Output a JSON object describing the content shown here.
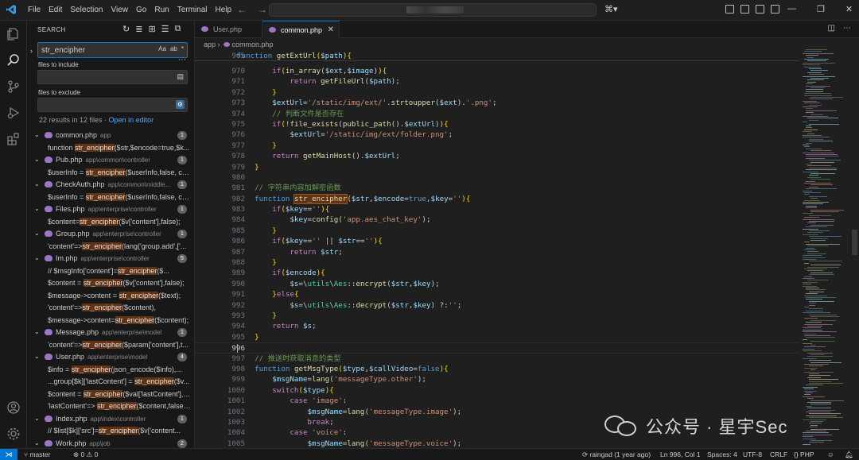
{
  "titlebar": {
    "menu": [
      "File",
      "Edit",
      "Selection",
      "View",
      "Go",
      "Run",
      "Terminal",
      "Help"
    ]
  },
  "colors": {
    "accent": "#0078d4",
    "match_highlight": "#613214",
    "php_icon": "#a074c4"
  },
  "sidebar": {
    "title": "SEARCH",
    "search_value": "str_encipher",
    "search_opts": [
      "Aa",
      "ab",
      "*"
    ],
    "include_label": "files to include",
    "exclude_label": "files to exclude",
    "summary": "22 results in 12 files",
    "open_in_editor": "Open in editor",
    "files": [
      {
        "name": "common.php",
        "path": "app",
        "count": "1",
        "matches": [
          [
            "function ",
            "str_encipher",
            "($str,$encode=true,$k..."
          ]
        ]
      },
      {
        "name": "Pub.php",
        "path": "app\\common\\controller",
        "count": "1",
        "matches": [
          [
            "$userInfo = ",
            "str_encipher",
            "($userInfo,false, co..."
          ]
        ]
      },
      {
        "name": "CheckAuth.php",
        "path": "app\\common\\middle...",
        "count": "1",
        "matches": [
          [
            "$userInfo = ",
            "str_encipher",
            "($userInfo,false, co..."
          ]
        ]
      },
      {
        "name": "Files.php",
        "path": "app\\enterprise\\controller",
        "count": "1",
        "matches": [
          [
            "$content=",
            "str_encipher",
            "($v['content'],false);"
          ]
        ]
      },
      {
        "name": "Group.php",
        "path": "app\\enterprise\\controller",
        "count": "1",
        "matches": [
          [
            "'content'=>",
            "str_encipher",
            "(lang('group.add',['..."
          ]
        ]
      },
      {
        "name": "Im.php",
        "path": "app\\enterprise\\controller",
        "count": "5",
        "matches": [
          [
            "//        $msgInfo['content']=",
            "str_encipher",
            "($..."
          ],
          [
            "$content = ",
            "str_encipher",
            "($v['content'],false);"
          ],
          [
            "$message->content = ",
            "str_encipher",
            "($text);"
          ],
          [
            "'content'=>",
            "str_encipher",
            "($content),"
          ],
          [
            "$message->content=",
            "str_encipher",
            "($content);"
          ]
        ]
      },
      {
        "name": "Message.php",
        "path": "app\\enterprise\\model",
        "count": "1",
        "matches": [
          [
            "'content'=>",
            "str_encipher",
            "($param['content'],t..."
          ]
        ]
      },
      {
        "name": "User.php",
        "path": "app\\enterprise\\model",
        "count": "4",
        "matches": [
          [
            "$info     = ",
            "str_encipher",
            "(json_encode($info),..."
          ],
          [
            "...group[$k]['lastContent'] = ",
            "str_encipher",
            "($v..."
          ],
          [
            "$content = ",
            "str_encipher",
            "($val['lastContent'],f..."
          ],
          [
            "'lastContent'=> ",
            "str_encipher",
            "($content,false)..."
          ]
        ]
      },
      {
        "name": "Index.php",
        "path": "app\\index\\controller",
        "count": "1",
        "matches": [
          [
            "//    $list[$k]['src']=",
            "str_encipher",
            "($v['content..."
          ]
        ]
      },
      {
        "name": "Work.php",
        "path": "app\\job",
        "count": "2",
        "matches": []
      }
    ]
  },
  "tabs": [
    {
      "label": "User.php",
      "active": false
    },
    {
      "label": "common.php",
      "active": true
    }
  ],
  "breadcrumb": [
    "app",
    "common.php"
  ],
  "editor": {
    "sticky": {
      "no": "965",
      "code": [
        [
          "k",
          "function "
        ],
        [
          "f",
          "getExtUrl"
        ],
        [
          "y",
          "("
        ],
        [
          "v",
          "$path"
        ],
        [
          "y",
          ")"
        ],
        [
          "y",
          "{"
        ]
      ]
    },
    "lines": [
      {
        "no": "970",
        "code": [
          [
            "p",
            "        "
          ],
          [
            "c",
            "if"
          ],
          [
            "y",
            "("
          ],
          [
            "f",
            "in_array"
          ],
          [
            "p",
            "("
          ],
          [
            "v",
            "$ext"
          ],
          [
            "p",
            ","
          ],
          [
            "v",
            "$image"
          ],
          [
            "p",
            ")"
          ],
          [
            "y",
            ")"
          ],
          [
            "y",
            "{"
          ]
        ]
      },
      {
        "no": "971",
        "code": [
          [
            "p",
            "            "
          ],
          [
            "c",
            "return "
          ],
          [
            "f",
            "getFileUrl"
          ],
          [
            "p",
            "("
          ],
          [
            "v",
            "$path"
          ],
          [
            "p",
            ");"
          ]
        ]
      },
      {
        "no": "972",
        "code": [
          [
            "p",
            "        "
          ],
          [
            "y",
            "}"
          ]
        ]
      },
      {
        "no": "973",
        "code": [
          [
            "p",
            "        "
          ],
          [
            "v",
            "$extUrl"
          ],
          [
            "p",
            "="
          ],
          [
            "s",
            "'/static/img/ext/'"
          ],
          [
            "p",
            "."
          ],
          [
            "f",
            "strtoupper"
          ],
          [
            "p",
            "("
          ],
          [
            "v",
            "$ext"
          ],
          [
            "p",
            ")."
          ],
          [
            "s",
            "'.png'"
          ],
          [
            "p",
            ";"
          ]
        ]
      },
      {
        "no": "974",
        "code": [
          [
            "p",
            "        "
          ],
          [
            "cm",
            "// 判断文件是否存在"
          ]
        ]
      },
      {
        "no": "975",
        "code": [
          [
            "p",
            "        "
          ],
          [
            "c",
            "if"
          ],
          [
            "y",
            "("
          ],
          [
            "p",
            "!"
          ],
          [
            "f",
            "file_exists"
          ],
          [
            "p",
            "("
          ],
          [
            "f",
            "public_path"
          ],
          [
            "p",
            "()."
          ],
          [
            "v",
            "$extUrl"
          ],
          [
            "p",
            ")"
          ],
          [
            "y",
            ")"
          ],
          [
            "y",
            "{"
          ]
        ]
      },
      {
        "no": "976",
        "code": [
          [
            "p",
            "            "
          ],
          [
            "v",
            "$extUrl"
          ],
          [
            "p",
            "="
          ],
          [
            "s",
            "'/static/img/ext/folder.png'"
          ],
          [
            "p",
            ";"
          ]
        ]
      },
      {
        "no": "977",
        "code": [
          [
            "p",
            "        "
          ],
          [
            "y",
            "}"
          ]
        ]
      },
      {
        "no": "978",
        "code": [
          [
            "p",
            "        "
          ],
          [
            "c",
            "return "
          ],
          [
            "f",
            "getMainHost"
          ],
          [
            "p",
            "()."
          ],
          [
            "v",
            "$extUrl"
          ],
          [
            "p",
            ";"
          ]
        ]
      },
      {
        "no": "979",
        "code": [
          [
            "p",
            "    "
          ],
          [
            "y",
            "}"
          ]
        ]
      },
      {
        "no": "980",
        "code": []
      },
      {
        "no": "981",
        "code": [
          [
            "p",
            "    "
          ],
          [
            "cm",
            "// 字符串内容加解密函数"
          ]
        ]
      },
      {
        "no": "982",
        "code": [
          [
            "p",
            "    "
          ],
          [
            "k",
            "function "
          ],
          [
            "m",
            "str_encipher"
          ],
          [
            "y",
            "("
          ],
          [
            "v",
            "$str"
          ],
          [
            "p",
            ","
          ],
          [
            "v",
            "$encode"
          ],
          [
            "p",
            "="
          ],
          [
            "k",
            "true"
          ],
          [
            "p",
            ","
          ],
          [
            "v",
            "$key"
          ],
          [
            "p",
            "="
          ],
          [
            "s",
            "''"
          ],
          [
            "y",
            ")"
          ],
          [
            "y",
            "{"
          ]
        ]
      },
      {
        "no": "983",
        "code": [
          [
            "p",
            "        "
          ],
          [
            "c",
            "if"
          ],
          [
            "y",
            "("
          ],
          [
            "v",
            "$key"
          ],
          [
            "p",
            "=="
          ],
          [
            "s",
            "''"
          ],
          [
            "y",
            ")"
          ],
          [
            "y",
            "{"
          ]
        ]
      },
      {
        "no": "984",
        "code": [
          [
            "p",
            "            "
          ],
          [
            "v",
            "$key"
          ],
          [
            "p",
            "="
          ],
          [
            "f",
            "config"
          ],
          [
            "p",
            "("
          ],
          [
            "s",
            "'app.aes_chat_key'"
          ],
          [
            "p",
            ");"
          ]
        ]
      },
      {
        "no": "985",
        "code": [
          [
            "p",
            "        "
          ],
          [
            "y",
            "}"
          ]
        ]
      },
      {
        "no": "986",
        "code": [
          [
            "p",
            "        "
          ],
          [
            "c",
            "if"
          ],
          [
            "y",
            "("
          ],
          [
            "v",
            "$key"
          ],
          [
            "p",
            "=="
          ],
          [
            "s",
            "'' "
          ],
          [
            "p",
            "|| "
          ],
          [
            "v",
            "$str"
          ],
          [
            "p",
            "=="
          ],
          [
            "s",
            "''"
          ],
          [
            "y",
            ")"
          ],
          [
            "y",
            "{"
          ]
        ]
      },
      {
        "no": "987",
        "code": [
          [
            "p",
            "            "
          ],
          [
            "c",
            "return "
          ],
          [
            "v",
            "$str"
          ],
          [
            "p",
            ";"
          ]
        ]
      },
      {
        "no": "988",
        "code": [
          [
            "p",
            "        "
          ],
          [
            "y",
            "}"
          ]
        ]
      },
      {
        "no": "989",
        "code": [
          [
            "p",
            "        "
          ],
          [
            "c",
            "if"
          ],
          [
            "y",
            "("
          ],
          [
            "v",
            "$encode"
          ],
          [
            "y",
            ")"
          ],
          [
            "y",
            "{"
          ]
        ]
      },
      {
        "no": "990",
        "code": [
          [
            "p",
            "            "
          ],
          [
            "v",
            "$s"
          ],
          [
            "p",
            "=\\"
          ],
          [
            "t",
            "utils"
          ],
          [
            "p",
            "\\"
          ],
          [
            "t",
            "Aes"
          ],
          [
            "p",
            "::"
          ],
          [
            "f",
            "encrypt"
          ],
          [
            "p",
            "("
          ],
          [
            "v",
            "$str"
          ],
          [
            "p",
            ","
          ],
          [
            "v",
            "$key"
          ],
          [
            "p",
            ");"
          ]
        ]
      },
      {
        "no": "991",
        "code": [
          [
            "p",
            "        "
          ],
          [
            "y",
            "}"
          ],
          [
            "c",
            "else"
          ],
          [
            "y",
            "{"
          ]
        ]
      },
      {
        "no": "992",
        "code": [
          [
            "p",
            "            "
          ],
          [
            "v",
            "$s"
          ],
          [
            "p",
            "=\\"
          ],
          [
            "t",
            "utils"
          ],
          [
            "p",
            "\\"
          ],
          [
            "t",
            "Aes"
          ],
          [
            "p",
            "::"
          ],
          [
            "f",
            "decrypt"
          ],
          [
            "p",
            "("
          ],
          [
            "v",
            "$str"
          ],
          [
            "p",
            ","
          ],
          [
            "v",
            "$key"
          ],
          [
            "p",
            ") ?:"
          ],
          [
            "s",
            "''"
          ],
          [
            "p",
            ";"
          ]
        ]
      },
      {
        "no": "993",
        "code": [
          [
            "p",
            "        "
          ],
          [
            "y",
            "}"
          ]
        ]
      },
      {
        "no": "994",
        "code": [
          [
            "p",
            "        "
          ],
          [
            "c",
            "return "
          ],
          [
            "v",
            "$s"
          ],
          [
            "p",
            ";"
          ]
        ]
      },
      {
        "no": "995",
        "code": [
          [
            "p",
            "    "
          ],
          [
            "y",
            "}"
          ]
        ]
      },
      {
        "no": "996",
        "code": [],
        "current": true
      },
      {
        "no": "997",
        "code": [
          [
            "p",
            "    "
          ],
          [
            "cm",
            "// 推送时获取消息的类型"
          ]
        ]
      },
      {
        "no": "998",
        "code": [
          [
            "p",
            "    "
          ],
          [
            "k",
            "function "
          ],
          [
            "f",
            "getMsgType"
          ],
          [
            "y",
            "("
          ],
          [
            "v",
            "$type"
          ],
          [
            "p",
            ","
          ],
          [
            "v",
            "$callVideo"
          ],
          [
            "p",
            "="
          ],
          [
            "k",
            "false"
          ],
          [
            "y",
            ")"
          ],
          [
            "y",
            "{"
          ]
        ]
      },
      {
        "no": "999",
        "code": [
          [
            "p",
            "        "
          ],
          [
            "v",
            "$msgName"
          ],
          [
            "p",
            "="
          ],
          [
            "f",
            "lang"
          ],
          [
            "p",
            "("
          ],
          [
            "s",
            "'messageType.other'"
          ],
          [
            "p",
            ");"
          ]
        ]
      },
      {
        "no": "1000",
        "code": [
          [
            "p",
            "        "
          ],
          [
            "c",
            "switch"
          ],
          [
            "y",
            "("
          ],
          [
            "v",
            "$type"
          ],
          [
            "y",
            ")"
          ],
          [
            "y",
            "{"
          ]
        ]
      },
      {
        "no": "1001",
        "code": [
          [
            "p",
            "            "
          ],
          [
            "c",
            "case "
          ],
          [
            "s",
            "'image'"
          ],
          [
            "p",
            ":"
          ]
        ]
      },
      {
        "no": "1002",
        "code": [
          [
            "p",
            "                "
          ],
          [
            "v",
            "$msgName"
          ],
          [
            "p",
            "="
          ],
          [
            "f",
            "lang"
          ],
          [
            "p",
            "("
          ],
          [
            "s",
            "'messageType.image'"
          ],
          [
            "p",
            ");"
          ]
        ]
      },
      {
        "no": "1003",
        "code": [
          [
            "p",
            "                "
          ],
          [
            "c",
            "break"
          ],
          [
            "p",
            ";"
          ]
        ]
      },
      {
        "no": "1004",
        "code": [
          [
            "p",
            "            "
          ],
          [
            "c",
            "case "
          ],
          [
            "s",
            "'voice'"
          ],
          [
            "p",
            ":"
          ]
        ]
      },
      {
        "no": "1005",
        "code": [
          [
            "p",
            "                "
          ],
          [
            "v",
            "$msgName"
          ],
          [
            "p",
            "="
          ],
          [
            "f",
            "lang"
          ],
          [
            "p",
            "("
          ],
          [
            "s",
            "'messageType.voice'"
          ],
          [
            "p",
            ");"
          ]
        ]
      }
    ]
  },
  "statusbar": {
    "branch": "master",
    "problems": "0",
    "warnings": "0",
    "blame": "raingad (1 year ago)",
    "position": "Ln 996, Col 1",
    "spaces": "Spaces: 4",
    "encoding": "UTF-8",
    "eol": "CRLF",
    "language": "PHP"
  },
  "watermark": {
    "text": "公众号 · 星宇Sec"
  }
}
